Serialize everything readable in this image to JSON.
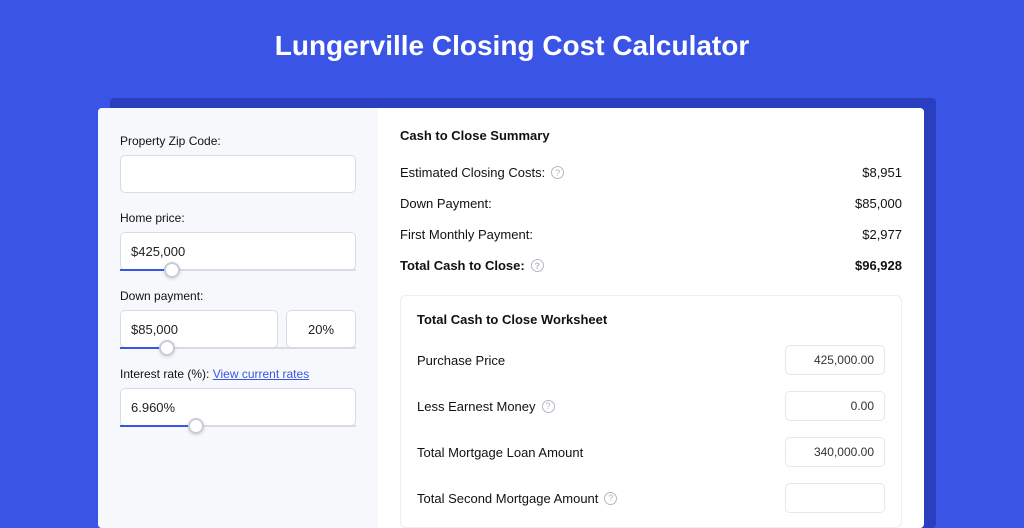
{
  "page_title": "Lungerville Closing Cost Calculator",
  "inputs": {
    "zip": {
      "label": "Property Zip Code:",
      "value": ""
    },
    "home_price": {
      "label": "Home price:",
      "value": "$425,000",
      "slider_pct": 22
    },
    "down_payment": {
      "label": "Down payment:",
      "amount": "$85,000",
      "percent": "20%",
      "slider_pct": 20
    },
    "interest_rate": {
      "label_prefix": "Interest rate (%): ",
      "link_text": "View current rates",
      "value": "6.960%",
      "slider_pct": 32
    }
  },
  "summary": {
    "title": "Cash to Close Summary",
    "rows": [
      {
        "label": "Estimated Closing Costs:",
        "help": true,
        "value": "$8,951",
        "bold": false
      },
      {
        "label": "Down Payment:",
        "help": false,
        "value": "$85,000",
        "bold": false
      },
      {
        "label": "First Monthly Payment:",
        "help": false,
        "value": "$2,977",
        "bold": false
      },
      {
        "label": "Total Cash to Close:",
        "help": true,
        "value": "$96,928",
        "bold": true
      }
    ]
  },
  "worksheet": {
    "title": "Total Cash to Close Worksheet",
    "rows": [
      {
        "label": "Purchase Price",
        "help": false,
        "value": "425,000.00"
      },
      {
        "label": "Less Earnest Money",
        "help": true,
        "value": "0.00"
      },
      {
        "label": "Total Mortgage Loan Amount",
        "help": false,
        "value": "340,000.00"
      },
      {
        "label": "Total Second Mortgage Amount",
        "help": true,
        "value": ""
      }
    ]
  }
}
